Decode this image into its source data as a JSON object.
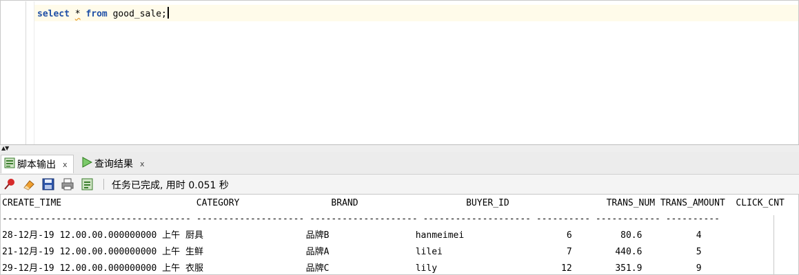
{
  "editor": {
    "sql_keyword_select": "select",
    "sql_star": "*",
    "sql_keyword_from": "from",
    "sql_rest": "good_sale;"
  },
  "splitter": {
    "arrows": "▲▼"
  },
  "tabs": [
    {
      "label": "脚本输出",
      "close": "x",
      "icon": "script-output-icon"
    },
    {
      "label": "查询结果",
      "close": "x",
      "icon": "run-arrow-icon"
    }
  ],
  "toolbar": {
    "icons": [
      "pin-icon",
      "eraser-icon",
      "save-icon",
      "print-icon",
      "export-icon"
    ],
    "status": "任务已完成, 用时 0.051 秒"
  },
  "output": {
    "header": "CREATE_TIME                         CATEGORY                 BRAND                    BUYER_ID                  TRANS_NUM TRANS_AMOUNT  CLICK_CNT",
    "rule": "----------------------------------- -------------------- -------------------- -------------------- ---------- ------------ ----------",
    "rows": [
      "28-12月-19 12.00.00.000000000 上午 厨具                   品牌B                hanmeimei                   6         80.6          4",
      "21-12月-19 12.00.00.000000000 上午 生鲜                   品牌A                lilei                       7        440.6          5",
      "29-12月-19 12.00.00.000000000 上午 衣服                   品牌C                lily                       12        351.9          9"
    ]
  }
}
